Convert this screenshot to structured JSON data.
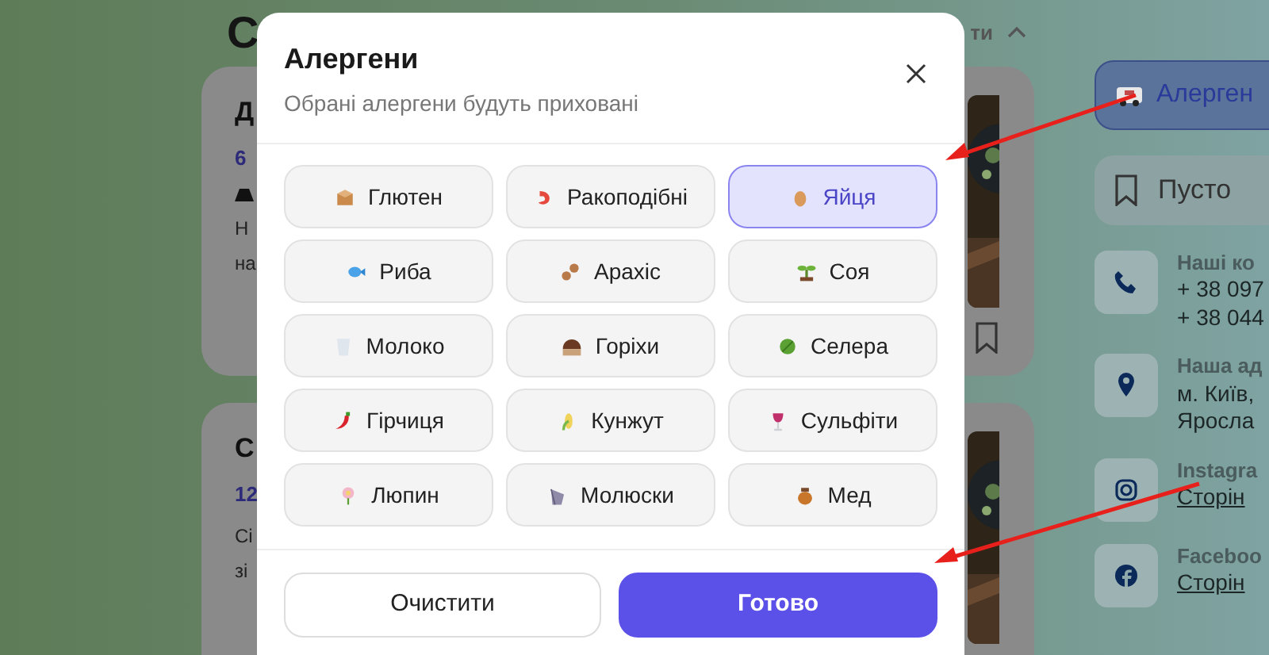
{
  "page": {
    "heading": "С",
    "sort_label": "ти",
    "cards": [
      {
        "title": "Д",
        "price": "6",
        "lines": [
          "Н",
          "на"
        ],
        "has_weight": true,
        "has_bookmark": true
      },
      {
        "title": "С",
        "price": "12",
        "lines": [
          "Сі",
          "зі"
        ],
        "has_weight": false
      }
    ],
    "sidebar": {
      "allergens_button": "Алерген",
      "favorites": "Пусто",
      "contacts": [
        {
          "kind": "phone",
          "label": "Наші ко",
          "lines": [
            "+ 38 097",
            "+ 38 044"
          ],
          "link": false
        },
        {
          "kind": "pin",
          "label": "Наша ад",
          "lines": [
            "м. Київ,",
            "Яросла"
          ],
          "link": false
        },
        {
          "kind": "instagram",
          "label": "Instagra",
          "lines": [
            "Сторін"
          ],
          "link": true
        },
        {
          "kind": "facebook",
          "label": "Faceboo",
          "lines": [
            "Сторін"
          ],
          "link": true
        }
      ]
    }
  },
  "dialog": {
    "title": "Алергени",
    "subtitle": "Обрані алергени будуть приховані",
    "allergens": [
      {
        "label": "Глютен",
        "selected": false
      },
      {
        "label": "Ракоподібні",
        "selected": false
      },
      {
        "label": "Яйця",
        "selected": true
      },
      {
        "label": "Риба",
        "selected": false
      },
      {
        "label": "Арахіс",
        "selected": false
      },
      {
        "label": "Соя",
        "selected": false
      },
      {
        "label": "Молоко",
        "selected": false
      },
      {
        "label": "Горіхи",
        "selected": false
      },
      {
        "label": "Селера",
        "selected": false
      },
      {
        "label": "Гірчиця",
        "selected": false
      },
      {
        "label": "Кунжут",
        "selected": false
      },
      {
        "label": "Сульфіти",
        "selected": false
      },
      {
        "label": "Люпин",
        "selected": false
      },
      {
        "label": "Молюски",
        "selected": false
      },
      {
        "label": "Мед",
        "selected": false
      }
    ],
    "clear_button": "Очистити",
    "done_button": "Готово"
  }
}
